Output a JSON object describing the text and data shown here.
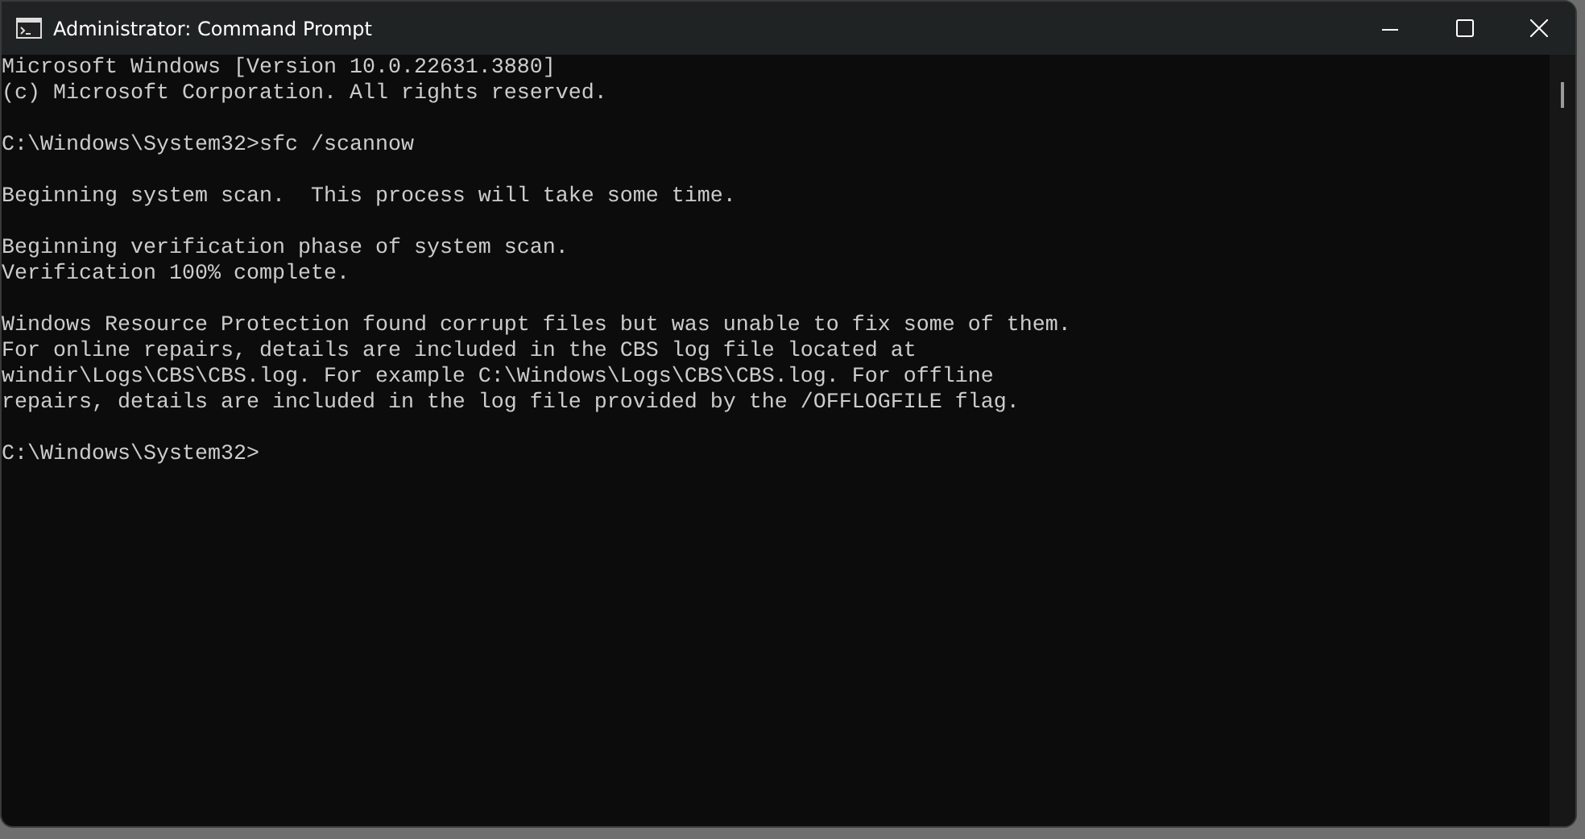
{
  "window": {
    "title": "Administrator: Command Prompt"
  },
  "console": {
    "blocks": [
      [
        "Microsoft Windows [Version 10.0.22631.3880]",
        "(c) Microsoft Corporation. All rights reserved."
      ],
      [
        "C:\\Windows\\System32>sfc /scannow"
      ],
      [
        "Beginning system scan.  This process will take some time."
      ],
      [
        "Beginning verification phase of system scan.",
        "Verification 100% complete."
      ],
      [
        "Windows Resource Protection found corrupt files but was unable to fix some of them.",
        "For online repairs, details are included in the CBS log file located at",
        "windir\\Logs\\CBS\\CBS.log. For example C:\\Windows\\Logs\\CBS\\CBS.log. For offline",
        "repairs, details are included in the log file provided by the /OFFLOGFILE flag."
      ],
      [
        "C:\\Windows\\System32>"
      ]
    ]
  }
}
